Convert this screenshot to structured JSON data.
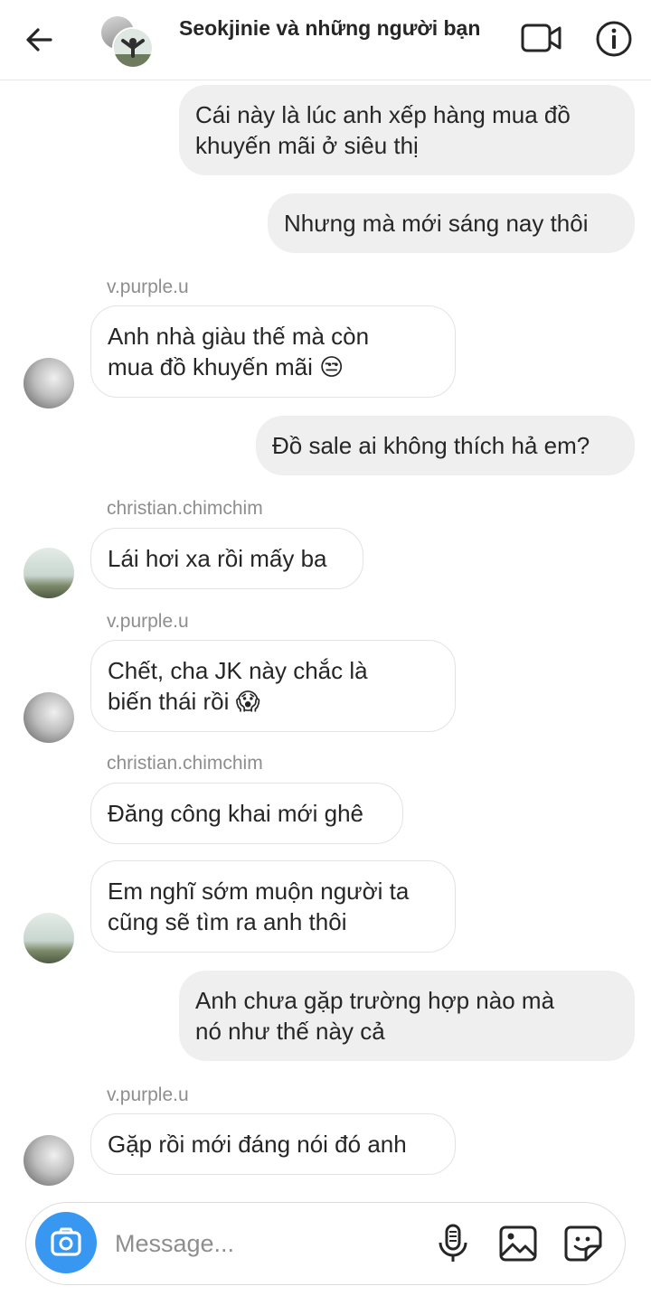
{
  "header": {
    "title": "Seokjinie và những người bạn",
    "back_icon": "arrow-left-icon",
    "video_icon": "video-camera-icon",
    "info_icon": "info-icon"
  },
  "messages": [
    {
      "from": "me",
      "lines": [
        "Cái này là lúc anh xếp hàng mua đồ",
        "khuyến mãi ở siêu thị"
      ]
    },
    {
      "from": "me",
      "lines": [
        "Nhưng mà mới sáng nay thôi"
      ]
    },
    {
      "sender": "v.purple.u",
      "lines": [
        "Anh nhà giàu thế mà còn",
        "mua đồ khuyến mãi 😒"
      ]
    },
    {
      "from": "me",
      "lines": [
        "Đồ sale ai không thích hả em?"
      ]
    },
    {
      "sender": "christian.chimchim",
      "lines": [
        "Lái hơi xa rồi mấy ba"
      ]
    },
    {
      "sender": "v.purple.u",
      "lines": [
        "Chết, cha JK này chắc là",
        "biến thái rồi 😱"
      ]
    },
    {
      "sender": "christian.chimchim",
      "lines": [
        "Đăng công khai mới ghê"
      ]
    },
    {
      "sender": "christian.chimchim",
      "lines": [
        "Em nghĩ sớm muộn người ta",
        "cũng sẽ tìm ra anh thôi"
      ]
    },
    {
      "from": "me",
      "lines": [
        "Anh chưa gặp trường hợp nào mà",
        "nó như thế này cả"
      ]
    },
    {
      "sender": "v.purple.u",
      "lines": [
        "Gặp rồi mới đáng nói đó anh"
      ]
    }
  ],
  "composer": {
    "placeholder": "Message...",
    "camera_icon": "camera-icon",
    "mic_icon": "microphone-icon",
    "gallery_icon": "gallery-icon",
    "sticker_icon": "sticker-icon"
  },
  "colors": {
    "accent": "#3897f0",
    "my_bubble": "#efefef",
    "meta_text": "#8e8e8e"
  }
}
